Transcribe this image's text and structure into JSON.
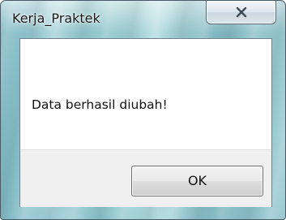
{
  "window": {
    "title": "Kerja_Praktek"
  },
  "titlebar": {
    "close_icon": "close-icon"
  },
  "dialog": {
    "message": "Data berhasil diubah!",
    "ok_label": "OK"
  },
  "colors": {
    "frame": "#8cc4c9",
    "client_bg": "#ffffff",
    "button_area_bg": "#f0f0f0",
    "text": "#111111"
  }
}
